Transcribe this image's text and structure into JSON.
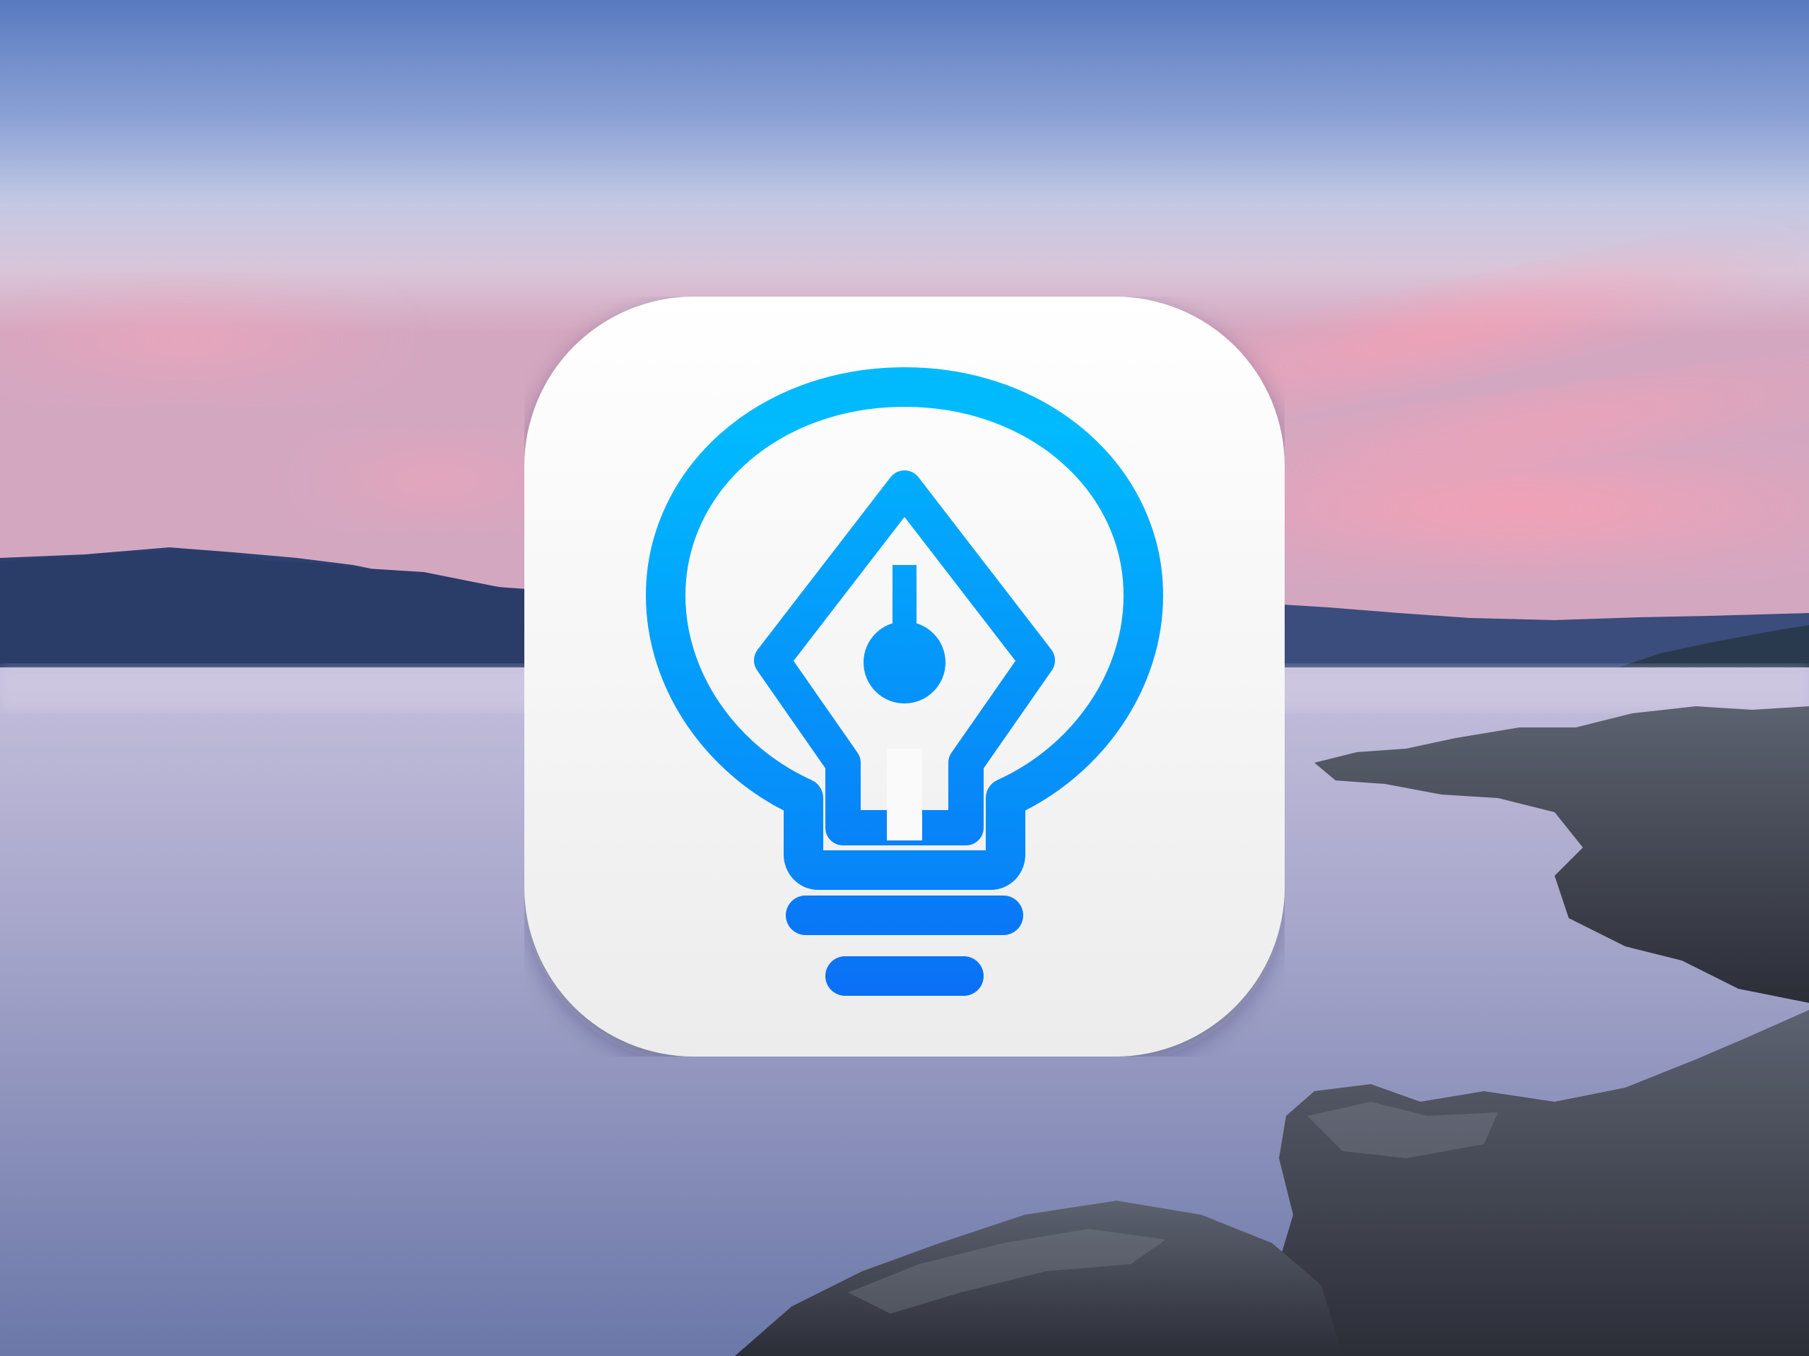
{
  "scene": {
    "description_name": "coastal-sunset-wallpaper",
    "colors": {
      "sky_top": "#5b7fc4",
      "sky_mid": "#c9cfe6",
      "sky_glow": "#f0a6b8",
      "mountain": "#2c3f68",
      "water_top": "#bdb8d6",
      "water_bottom": "#6f7fae",
      "rock_dark": "#2a2d36",
      "rock_light": "#6d7280"
    }
  },
  "app_icon": {
    "icon_name": "lightbulb-pen-nib-icon",
    "colors": {
      "tile_top": "#ffffff",
      "tile_bottom": "#ececec",
      "glyph_top": "#00b8ff",
      "glyph_bottom": "#0a72f5"
    }
  }
}
